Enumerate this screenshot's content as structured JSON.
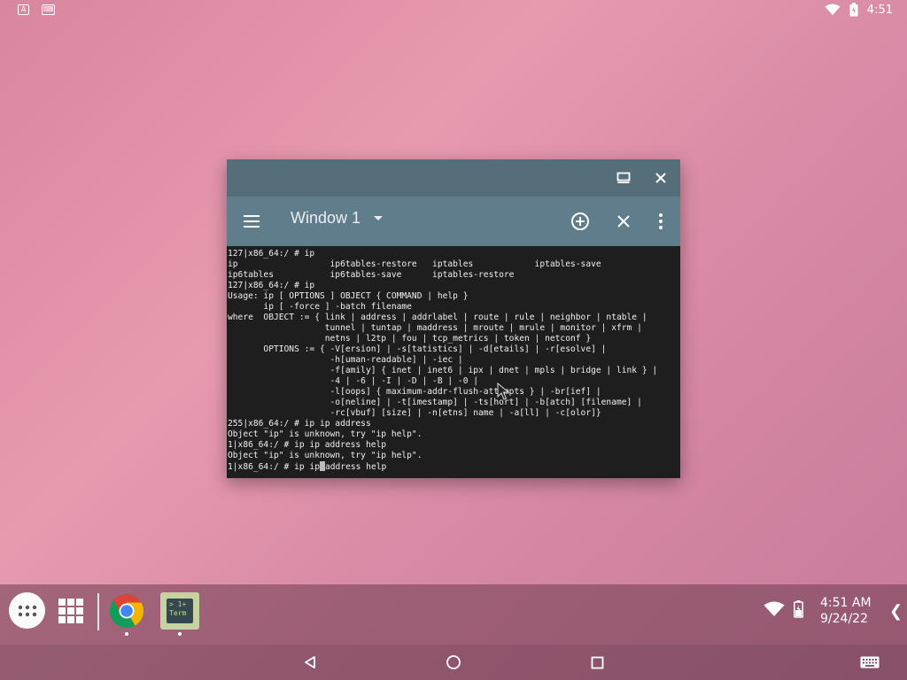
{
  "status_bar": {
    "time": "4:51",
    "left_icons": [
      "accessibility-icon",
      "keyboard-notification-icon"
    ],
    "right_icons": [
      "wifi-icon",
      "battery-icon"
    ]
  },
  "window": {
    "title_buttons": [
      "maximize-icon",
      "close-icon"
    ],
    "window_selector": "Window 1",
    "toolbar_icons": [
      "menu-icon",
      "dropdown-icon",
      "add-window-icon",
      "close-window-icon",
      "more-icon"
    ]
  },
  "terminal": {
    "lines": [
      "127|x86_64:/ # ip",
      "ip                  ip6tables-restore   iptables            iptables-save",
      "ip6tables           ip6tables-save      iptables-restore",
      "127|x86_64:/ # ip",
      "Usage: ip [ OPTIONS ] OBJECT { COMMAND | help }",
      "       ip [ -force ] -batch filename",
      "where  OBJECT := { link | address | addrlabel | route | rule | neighbor | ntable |",
      "                   tunnel | tuntap | maddress | mroute | mrule | monitor | xfrm |",
      "                   netns | l2tp | fou | tcp_metrics | token | netconf }",
      "       OPTIONS := { -V[ersion] | -s[tatistics] | -d[etails] | -r[esolve] |",
      "                    -h[uman-readable] | -iec |",
      "                    -f[amily] { inet | inet6 | ipx | dnet | mpls | bridge | link } |",
      "                    -4 | -6 | -I | -D | -B | -0 |",
      "                    -l[oops] { maximum-addr-flush-attempts } | -br[ief] |",
      "                    -o[neline] | -t[imestamp] | -ts[hort] | -b[atch] [filename] |",
      "                    -rc[vbuf] [size] | -n[etns] name | -a[ll] | -c[olor]}",
      "255|x86_64:/ # ip ip address",
      "Object \"ip\" is unknown, try \"ip help\".",
      "1|x86_64:/ # ip ip address help",
      "Object \"ip\" is unknown, try \"ip help\"."
    ],
    "last_line_before_cursor": "1|x86_64:/ # ip ip",
    "last_line_after_cursor": "address help"
  },
  "taskbar": {
    "apps": [
      {
        "name": "app-drawer",
        "icon": "apps-dots-icon"
      },
      {
        "name": "app-grid",
        "icon": "grid-icon"
      },
      {
        "name": "chrome",
        "icon": "chrome-icon"
      },
      {
        "name": "terminal",
        "icon": "terminal-icon",
        "label_top": "> 1+",
        "label_bottom": "Term"
      }
    ],
    "clock_time": "4:51 AM",
    "clock_date": "9/24/22",
    "expand_glyph": "❮"
  },
  "nav_bar": {
    "buttons": [
      "back-icon",
      "home-icon",
      "recents-icon",
      "keyboard-icon"
    ]
  }
}
